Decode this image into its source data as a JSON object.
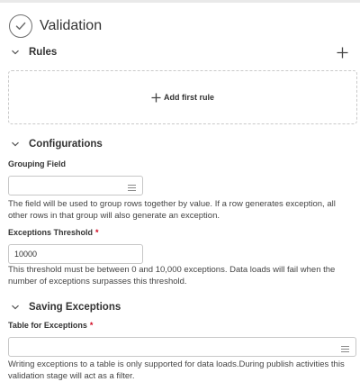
{
  "header": {
    "title": "Validation"
  },
  "rules": {
    "title": "Rules",
    "add_first_rule": "Add first rule"
  },
  "configurations": {
    "title": "Configurations",
    "grouping_field": {
      "label": "Grouping Field",
      "value": "",
      "help": "The field will be used to group rows together by value. If a row generates exception, all other rows in that group will also generate an exception."
    },
    "exceptions_threshold": {
      "label": "Exceptions Threshold",
      "required": "*",
      "value": "10000",
      "help": "This threshold must be between 0 and 10,000 exceptions. Data loads will fail when the number of exceptions surpasses this threshold."
    }
  },
  "saving_exceptions": {
    "title": "Saving Exceptions",
    "table_for_exceptions": {
      "label": "Table for Exceptions",
      "required": "*",
      "value": "",
      "help": "Writing exceptions to a table is only supported for data loads.During publish activities this validation stage will act as a filter."
    }
  },
  "colors": {
    "required": "#d0021b",
    "border": "#c7c7c7",
    "dashed_border": "#c9c9c9"
  },
  "icons": [
    "check-circle-icon",
    "chevron-down-icon",
    "plus-icon",
    "list-icon"
  ]
}
